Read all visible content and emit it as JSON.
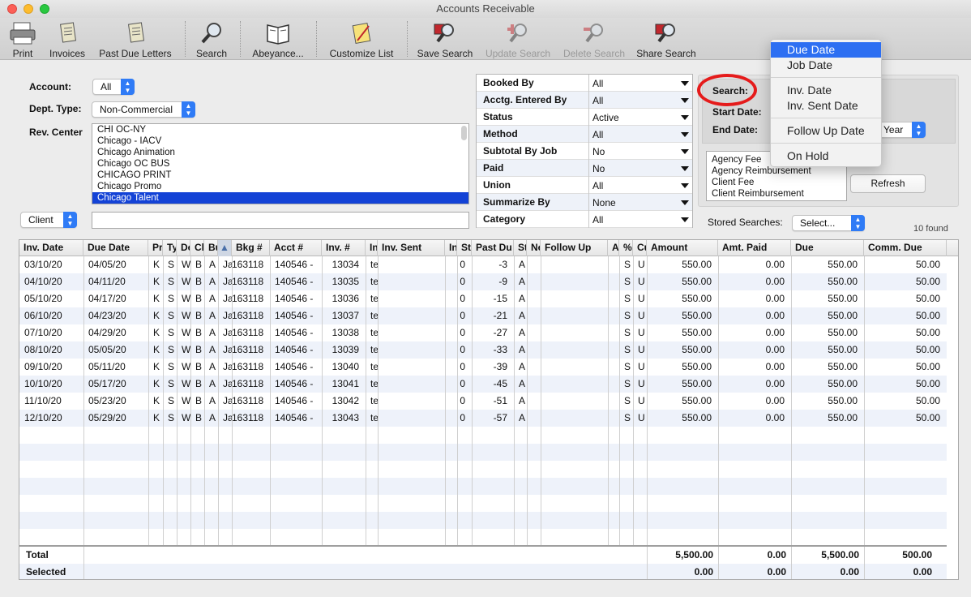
{
  "window": {
    "title": "Accounts Receivable"
  },
  "toolbar": {
    "print": "Print",
    "invoices": "Invoices",
    "past_due": "Past Due Letters",
    "search": "Search",
    "abeyance": "Abeyance...",
    "customize": "Customize List",
    "save_search": "Save Search",
    "update_search": "Update Search",
    "delete_search": "Delete Search",
    "share_search": "Share Search"
  },
  "filters": {
    "account_label": "Account:",
    "account_value": "All",
    "dept_label": "Dept. Type:",
    "dept_value": "Non-Commercial",
    "rev_label": "Rev. Center",
    "rev_items": [
      "CHI OC-NY",
      "Chicago - IACV",
      "Chicago Animation",
      "Chicago OC BUS",
      "CHICAGO PRINT",
      "Chicago Promo",
      "Chicago Talent"
    ],
    "rev_selected": "Chicago Talent",
    "client_popup": "Client",
    "client_text": ""
  },
  "criteria": [
    {
      "k": "Booked By",
      "v": "All"
    },
    {
      "k": "Acctg. Entered By",
      "v": "All"
    },
    {
      "k": "Status",
      "v": "Active"
    },
    {
      "k": "Method",
      "v": "All"
    },
    {
      "k": "Subtotal By Job",
      "v": "No"
    },
    {
      "k": "Paid",
      "v": "No"
    },
    {
      "k": "Union",
      "v": "All"
    },
    {
      "k": "Summarize By",
      "v": "None"
    },
    {
      "k": "Category",
      "v": "All"
    }
  ],
  "search_panel": {
    "search_label": "Search:",
    "start_label": "Start Date:",
    "end_label": "End Date:",
    "period_value": "Year",
    "fee_items": [
      "Agency Fee",
      "Agency Reimbursement",
      "Client Fee",
      "Client Reimbursement"
    ],
    "refresh": "Refresh",
    "stored_label": "Stored Searches:",
    "stored_value": "Select...",
    "found": "10 found"
  },
  "search_menu": {
    "items": [
      "Due Date",
      "Job Date",
      "Inv. Date",
      "Inv. Sent Date",
      "Follow Up Date",
      "On Hold"
    ],
    "highlighted": "Due Date"
  },
  "table": {
    "headers": [
      "Inv. Date",
      "Due Date",
      "Pr",
      "Ty",
      "De",
      "Cl",
      "Bu",
      "▲",
      "Bkg #",
      "Acct #",
      "Inv. #",
      "In",
      "Inv. Sent",
      "In",
      "St",
      "Past Du",
      "St",
      "Ne",
      "Follow Up",
      "Ac",
      "%",
      "Cu",
      "Amount",
      "Amt. Paid",
      "Due",
      "Comm. Due"
    ],
    "rows": [
      [
        "03/10/20",
        "04/05/20",
        "K",
        "S",
        "W",
        "B",
        "A",
        "Ja",
        "163118",
        "140546 -",
        "13034",
        "te",
        "",
        "",
        "0",
        "-3",
        "A",
        "",
        "",
        "",
        "S",
        "U",
        "550.00",
        "0.00",
        "550.00",
        "50.00"
      ],
      [
        "04/10/20",
        "04/11/20",
        "K",
        "S",
        "W",
        "B",
        "A",
        "Ja",
        "163118",
        "140546 -",
        "13035",
        "te",
        "",
        "",
        "0",
        "-9",
        "A",
        "",
        "",
        "",
        "S",
        "U",
        "550.00",
        "0.00",
        "550.00",
        "50.00"
      ],
      [
        "05/10/20",
        "04/17/20",
        "K",
        "S",
        "W",
        "B",
        "A",
        "Ja",
        "163118",
        "140546 -",
        "13036",
        "te",
        "",
        "",
        "0",
        "-15",
        "A",
        "",
        "",
        "",
        "S",
        "U",
        "550.00",
        "0.00",
        "550.00",
        "50.00"
      ],
      [
        "06/10/20",
        "04/23/20",
        "K",
        "S",
        "W",
        "B",
        "A",
        "Ja",
        "163118",
        "140546 -",
        "13037",
        "te",
        "",
        "",
        "0",
        "-21",
        "A",
        "",
        "",
        "",
        "S",
        "U",
        "550.00",
        "0.00",
        "550.00",
        "50.00"
      ],
      [
        "07/10/20",
        "04/29/20",
        "K",
        "S",
        "W",
        "B",
        "A",
        "Ja",
        "163118",
        "140546 -",
        "13038",
        "te",
        "",
        "",
        "0",
        "-27",
        "A",
        "",
        "",
        "",
        "S",
        "U",
        "550.00",
        "0.00",
        "550.00",
        "50.00"
      ],
      [
        "08/10/20",
        "05/05/20",
        "K",
        "S",
        "W",
        "B",
        "A",
        "Ja",
        "163118",
        "140546 -",
        "13039",
        "te",
        "",
        "",
        "0",
        "-33",
        "A",
        "",
        "",
        "",
        "S",
        "U",
        "550.00",
        "0.00",
        "550.00",
        "50.00"
      ],
      [
        "09/10/20",
        "05/11/20",
        "K",
        "S",
        "W",
        "B",
        "A",
        "Ja",
        "163118",
        "140546 -",
        "13040",
        "te",
        "",
        "",
        "0",
        "-39",
        "A",
        "",
        "",
        "",
        "S",
        "U",
        "550.00",
        "0.00",
        "550.00",
        "50.00"
      ],
      [
        "10/10/20",
        "05/17/20",
        "K",
        "S",
        "W",
        "B",
        "A",
        "Ja",
        "163118",
        "140546 -",
        "13041",
        "te",
        "",
        "",
        "0",
        "-45",
        "A",
        "",
        "",
        "",
        "S",
        "U",
        "550.00",
        "0.00",
        "550.00",
        "50.00"
      ],
      [
        "11/10/20",
        "05/23/20",
        "K",
        "S",
        "W",
        "B",
        "A",
        "Ja",
        "163118",
        "140546 -",
        "13042",
        "te",
        "",
        "",
        "0",
        "-51",
        "A",
        "",
        "",
        "",
        "S",
        "U",
        "550.00",
        "0.00",
        "550.00",
        "50.00"
      ],
      [
        "12/10/20",
        "05/29/20",
        "K",
        "S",
        "W",
        "B",
        "A",
        "Ja",
        "163118",
        "140546 -",
        "13043",
        "te",
        "",
        "",
        "0",
        "-57",
        "A",
        "",
        "",
        "",
        "S",
        "U",
        "550.00",
        "0.00",
        "550.00",
        "50.00"
      ]
    ],
    "total_label": "Total",
    "selected_label": "Selected",
    "totals": [
      "5,500.00",
      "0.00",
      "5,500.00",
      "500.00"
    ],
    "selected": [
      "0.00",
      "0.00",
      "0.00",
      "0.00"
    ]
  }
}
